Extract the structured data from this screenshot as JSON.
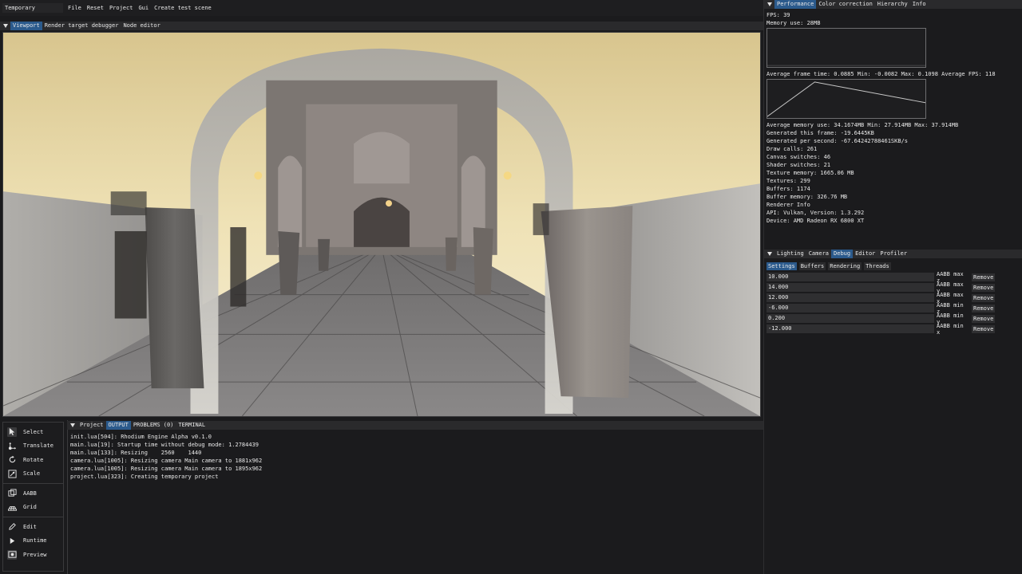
{
  "project_name": "Temporary",
  "menu": [
    "File",
    "Reset",
    "Project",
    "Gui",
    "Create test scene"
  ],
  "viewport_tabs": [
    {
      "label": "Viewport",
      "active": true
    },
    {
      "label": "Render target debugger",
      "active": false
    },
    {
      "label": "Node editor",
      "active": false
    }
  ],
  "right_tabs": [
    {
      "label": "Performance",
      "active": true
    },
    {
      "label": "Color correction",
      "active": false
    },
    {
      "label": "Hierarchy",
      "active": false
    },
    {
      "label": "Info",
      "active": false
    }
  ],
  "performance": {
    "fps": "FPS: 39",
    "memory": "Memory use: 28MB",
    "frame_time": "Average frame time: 0.0885 Min: -0.0082 Max: 0.1098 Average FPS: 118",
    "stats": [
      "Average memory use: 34.1674MB Min: 27.914MB Max: 37.914MB",
      "Generated this frame: -19.6445KB",
      "Generated per second: -67.64242788461SKB/s",
      "Draw calls: 261",
      "Canvas switches: 46",
      "Shader switches: 21",
      "Texture memory: 1665.06 MB",
      "Textures: 299",
      "Buffers: 1174",
      "Buffer memory: 326.76 MB",
      "Renderer Info",
      "API: Vulkan, Version: 1.3.292",
      "Device: AMD Radeon RX 6800 XT"
    ]
  },
  "debug_tabs": [
    {
      "label": "Lighting",
      "active": false
    },
    {
      "label": "Camera",
      "active": false
    },
    {
      "label": "Debug",
      "active": true
    },
    {
      "label": "Editor",
      "active": false
    },
    {
      "label": "Profiler",
      "active": false
    }
  ],
  "debug_subtabs": [
    {
      "label": "Settings",
      "active": true
    },
    {
      "label": "Buffers",
      "active": false
    },
    {
      "label": "Rendering",
      "active": false
    },
    {
      "label": "Threads",
      "active": false
    }
  ],
  "aabb": [
    {
      "value": "10.000",
      "label": "AABB max z",
      "button": "Remove"
    },
    {
      "value": "14.000",
      "label": "AABB max y",
      "button": "Remove"
    },
    {
      "value": "12.000",
      "label": "AABB max x",
      "button": "Remove"
    },
    {
      "value": "-6.000",
      "label": "AABB min z",
      "button": "Remove"
    },
    {
      "value": "0.200",
      "label": "AABB min y",
      "button": "Remove"
    },
    {
      "value": "-12.000",
      "label": "AABB min x",
      "button": "Remove"
    }
  ],
  "tools": {
    "select": "Select",
    "translate": "Translate",
    "rotate": "Rotate",
    "scale": "Scale",
    "aabb": "AABB",
    "grid": "Grid",
    "edit": "Edit",
    "runtime": "Runtime",
    "preview": "Preview"
  },
  "output_tabs": [
    {
      "label": "Project",
      "active": false
    },
    {
      "label": "OUTPUT",
      "active": true
    },
    {
      "label": "PROBLEMS (0)",
      "active": false
    },
    {
      "label": "TERMINAL",
      "active": false
    }
  ],
  "output_lines": [
    "init.lua[504]: Rhodium Engine Alpha v0.1.0",
    "main.lua[19]: Startup time without debug mode: 1.2784439",
    "main.lua[133]: Resizing    2560    1440",
    "camera.lua[1005]: Resizing camera Main camera to 1881x962",
    "camera.lua[1005]: Resizing camera Main camera to 1895x962",
    "project.lua[323]: Creating temporary project"
  ],
  "colors": {
    "accent": "#2b5a8c",
    "panel": "#1b1b1d",
    "input": "#2f2f31"
  }
}
